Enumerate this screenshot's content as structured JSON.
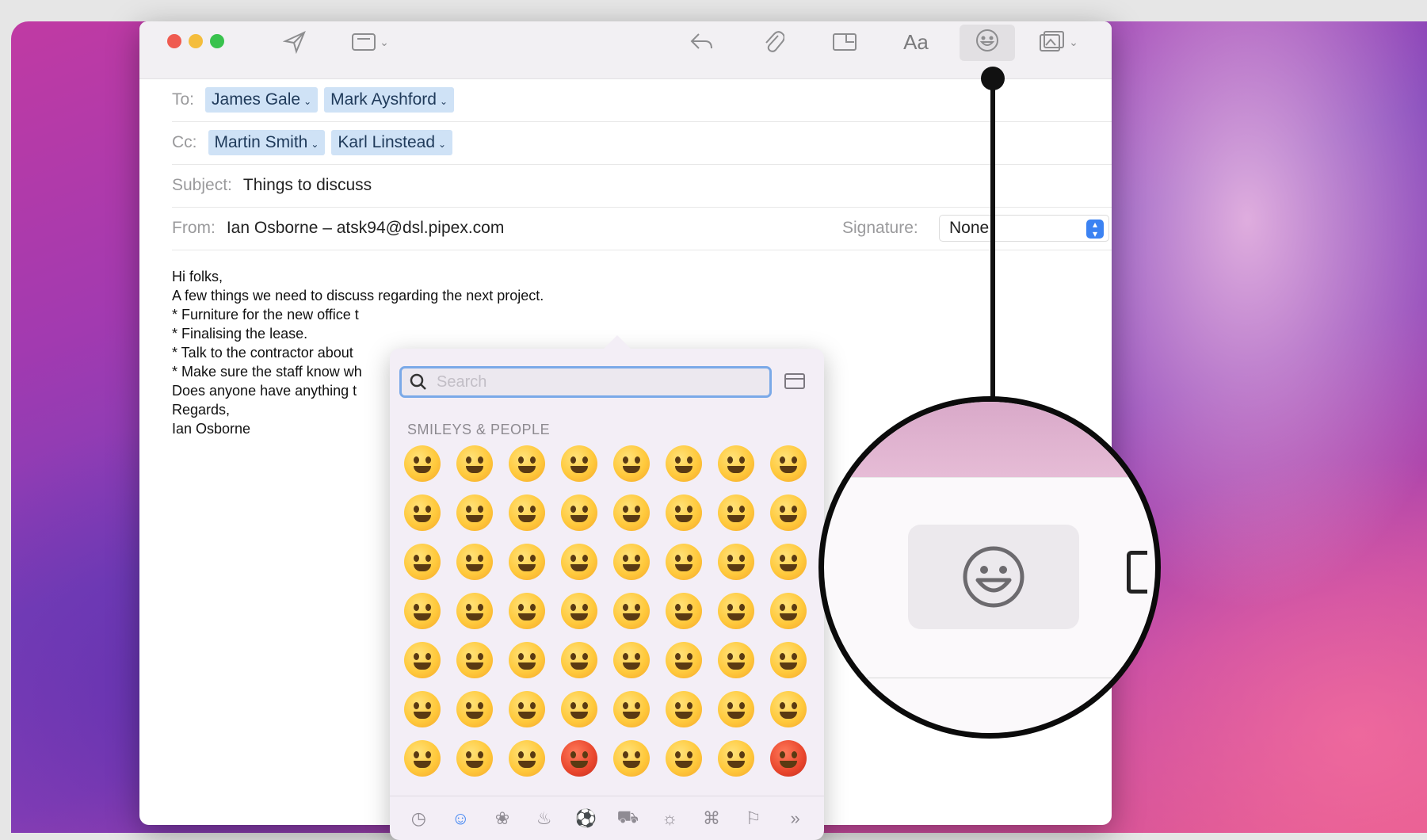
{
  "toolbar": {
    "send_icon": "paper-plane-icon",
    "header_icon": "header-fields-icon",
    "reply_icon": "reply-icon",
    "attach_icon": "paperclip-icon",
    "markup_icon": "markup-icon",
    "format_label": "Aa",
    "emoji_icon": "smiley-icon",
    "photo_icon": "photo-browser-icon"
  },
  "to": {
    "label": "To:",
    "recipients": [
      "James Gale",
      "Mark Ayshford"
    ]
  },
  "cc": {
    "label": "Cc:",
    "recipients": [
      "Martin Smith",
      "Karl Linstead"
    ]
  },
  "subject": {
    "label": "Subject:",
    "value": "Things to discuss"
  },
  "from": {
    "label": "From:",
    "value": "Ian Osborne – atsk94@dsl.pipex.com",
    "signature_label": "Signature:",
    "signature_value": "None"
  },
  "body": {
    "lines": [
      "Hi folks,",
      "",
      "A few things we need to discuss regarding the next project.",
      "",
      "* Furniture for the new office t",
      "* Finalising the lease.",
      "* Talk to the contractor about",
      "* Make sure the staff know wh",
      "",
      "Does anyone have anything t",
      "",
      "Regards,",
      "Ian Osborne"
    ]
  },
  "emoji_picker": {
    "search_placeholder": "Search",
    "section_title": "SMILEYS & PEOPLE",
    "more_label": "»",
    "category_icons": [
      "clock-icon",
      "smiley-icon",
      "animal-icon",
      "food-icon",
      "ball-icon",
      "car-icon",
      "lightbulb-icon",
      "symbols-icon",
      "flag-icon"
    ]
  }
}
